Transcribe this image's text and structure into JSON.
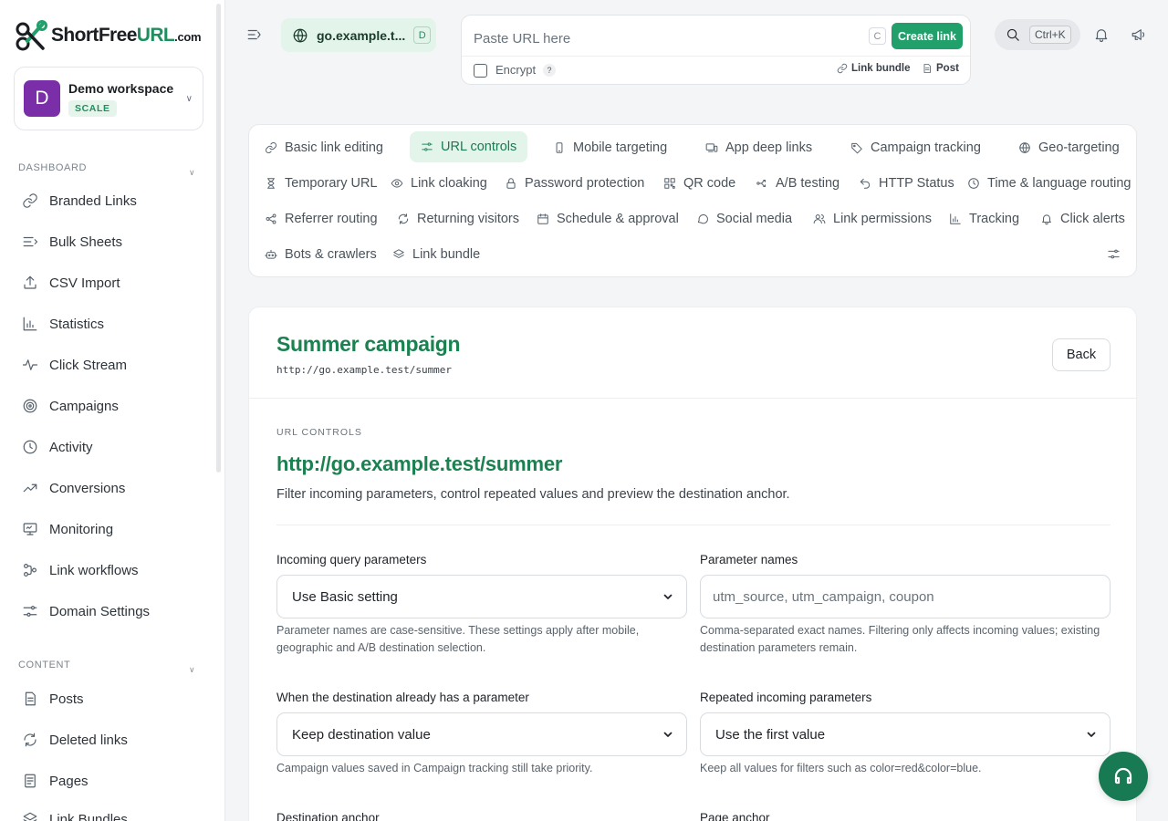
{
  "brand": {
    "name_dark": "ShortFree",
    "name_green": "URL",
    "name_suffix": ".com"
  },
  "workspace": {
    "initial": "D",
    "name": "Demo workspace",
    "plan": "SCALE"
  },
  "sidebar": {
    "sections": [
      {
        "label": "DASHBOARD"
      },
      {
        "label": "CONTENT"
      }
    ],
    "dashboard_items": [
      {
        "label": "Branded Links",
        "icon": "link-icon"
      },
      {
        "label": "Bulk Sheets",
        "icon": "list-icon"
      },
      {
        "label": "CSV Import",
        "icon": "upload-icon"
      },
      {
        "label": "Statistics",
        "icon": "bar-chart-icon"
      },
      {
        "label": "Click Stream",
        "icon": "pulse-icon"
      },
      {
        "label": "Campaigns",
        "icon": "target-icon"
      },
      {
        "label": "Activity",
        "icon": "clock-icon"
      },
      {
        "label": "Conversions",
        "icon": "trending-up-icon"
      },
      {
        "label": "Monitoring",
        "icon": "monitor-icon"
      },
      {
        "label": "Link workflows",
        "icon": "workflow-icon"
      },
      {
        "label": "Domain Settings",
        "icon": "sliders-icon"
      }
    ],
    "content_items": [
      {
        "label": "Posts",
        "icon": "document-icon"
      },
      {
        "label": "Deleted links",
        "icon": "refresh-icon"
      },
      {
        "label": "Pages",
        "icon": "page-icon"
      },
      {
        "label": "Link Bundles",
        "icon": "layers-icon"
      }
    ]
  },
  "topbar": {
    "domain": "go.example.t...",
    "domain_badge": "D",
    "url_placeholder": "Paste URL here",
    "url_shortcut": "C",
    "create_label": "Create link",
    "encrypt_label": "Encrypt",
    "encrypt_help": "?",
    "link_bundle_label": "Link bundle",
    "post_label": "Post",
    "search_shortcut": "Ctrl+K"
  },
  "tabs": [
    {
      "label": "Basic link editing",
      "icon": "link-icon"
    },
    {
      "label": "URL controls",
      "icon": "sliders-icon",
      "active": true
    },
    {
      "label": "Mobile targeting",
      "icon": "phone-icon"
    },
    {
      "label": "App deep links",
      "icon": "devices-icon"
    },
    {
      "label": "Campaign tracking",
      "icon": "tag-icon"
    },
    {
      "label": "Geo-targeting",
      "icon": "globe-icon"
    },
    {
      "label": "Temporary URL",
      "icon": "hourglass-icon"
    },
    {
      "label": "Link cloaking",
      "icon": "eye-icon"
    },
    {
      "label": "Password protection",
      "icon": "lock-icon"
    },
    {
      "label": "QR code",
      "icon": "qr-icon"
    },
    {
      "label": "A/B testing",
      "icon": "split-icon"
    },
    {
      "label": "HTTP Status",
      "icon": "undo-icon"
    },
    {
      "label": "Time & language routing",
      "icon": "clock-icon"
    },
    {
      "label": "Referrer routing",
      "icon": "share-icon"
    },
    {
      "label": "Returning visitors",
      "icon": "refresh-icon"
    },
    {
      "label": "Schedule & approval",
      "icon": "calendar-icon"
    },
    {
      "label": "Social media",
      "icon": "chat-icon"
    },
    {
      "label": "Link permissions",
      "icon": "users-icon"
    },
    {
      "label": "Tracking",
      "icon": "bar-chart-icon"
    },
    {
      "label": "Click alerts",
      "icon": "bell-icon"
    },
    {
      "label": "Bots & crawlers",
      "icon": "robot-icon"
    },
    {
      "label": "Link bundle",
      "icon": "layers-icon"
    }
  ],
  "link": {
    "name": "Summer campaign",
    "url": "http://go.example.test/summer",
    "back_label": "Back"
  },
  "url_controls": {
    "section_label": "URL CONTROLS",
    "title": "http://go.example.test/summer",
    "description": "Filter incoming parameters, control repeated values and preview the destination anchor.",
    "fields": {
      "incoming": {
        "label": "Incoming query parameters",
        "value": "Use Basic setting",
        "help": "Parameter names are case-sensitive. These settings apply after mobile, geographic and A/B destination selection."
      },
      "names": {
        "label": "Parameter names",
        "placeholder": "utm_source, utm_campaign, coupon",
        "help": "Comma-separated exact names. Filtering only affects incoming values; existing destination parameters remain."
      },
      "existing": {
        "label": "When the destination already has a parameter",
        "value": "Keep destination value",
        "help": "Campaign values saved in Campaign tracking still take priority."
      },
      "repeated": {
        "label": "Repeated incoming parameters",
        "value": "Use the first value",
        "help": "Keep all values for filters such as color=red&color=blue."
      },
      "dest_anchor": {
        "label": "Destination anchor"
      },
      "page_anchor": {
        "label": "Page anchor"
      }
    }
  }
}
